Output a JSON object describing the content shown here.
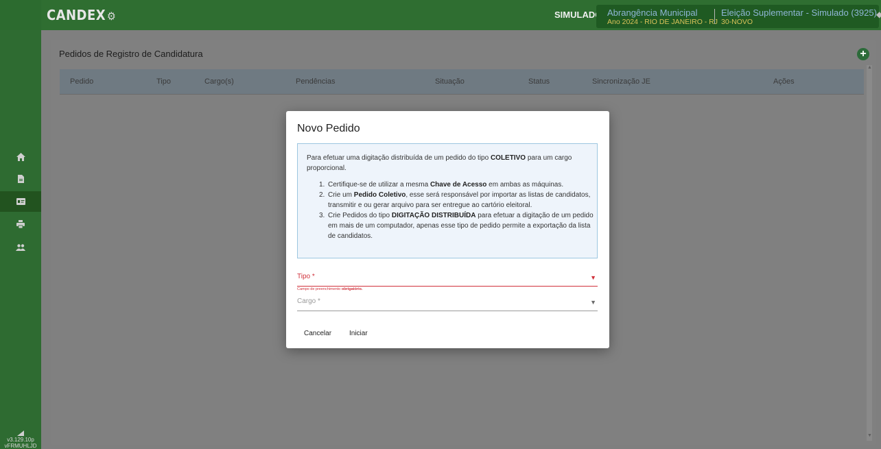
{
  "topbar": {
    "logo": "CANDEX",
    "mode": "SIMULADO",
    "abrangencia": {
      "title": "Abrangência Municipal",
      "subtitle": "Ano 2024 - RIO DE JANEIRO - RJ"
    },
    "eleicao": {
      "title": "Eleição Suplementar - Simulado (3925)",
      "subtitle": "30-NOVO"
    }
  },
  "sidebar": {
    "items": [
      {
        "icon": "home-icon"
      },
      {
        "icon": "document-icon"
      },
      {
        "icon": "id-card-icon",
        "active": true
      },
      {
        "icon": "printer-icon"
      },
      {
        "icon": "users-icon"
      }
    ],
    "version": "v3.129.10p",
    "build": "vFRMUHLJD"
  },
  "main": {
    "title": "Pedidos de Registro de Candidatura",
    "columns": [
      "Pedido",
      "Tipo",
      "Cargo(s)",
      "Pendências",
      "Situação",
      "Status",
      "Sincronização JE",
      "Ações"
    ]
  },
  "modal": {
    "title": "Novo Pedido",
    "info": {
      "intro_pre": "Para efetuar uma digitação distribuída de um pedido do tipo ",
      "intro_bold": "COLETIVO",
      "intro_post": " para um cargo proporcional.",
      "items": [
        {
          "num": "1.",
          "pre": "Certifique-se de utilizar a mesma ",
          "bold": "Chave de Acesso",
          "post": " em ambas as máquinas."
        },
        {
          "num": "2.",
          "pre": "Crie um ",
          "bold": "Pedido Coletivo",
          "post": ", esse será responsável por importar as listas de candidatos, transmitir e ou gerar arquivo para ser entregue ao cartório eleitoral."
        },
        {
          "num": "3.",
          "pre": "Crie Pedidos do tipo ",
          "bold": "DIGITAÇÃO DISTRIBUÍDA",
          "post": " para efetuar a digitação de um pedido em mais de um computador, apenas esse tipo de pedido permite a exportação da lista de candidatos."
        }
      ]
    },
    "tipo_label": "Tipo *",
    "tipo_error_pre": "Campo de preenchimento ",
    "tipo_error_bold": "obrigatório.",
    "cargo_label": "Cargo *",
    "cancel_label": "Cancelar",
    "start_label": "Iniciar"
  }
}
